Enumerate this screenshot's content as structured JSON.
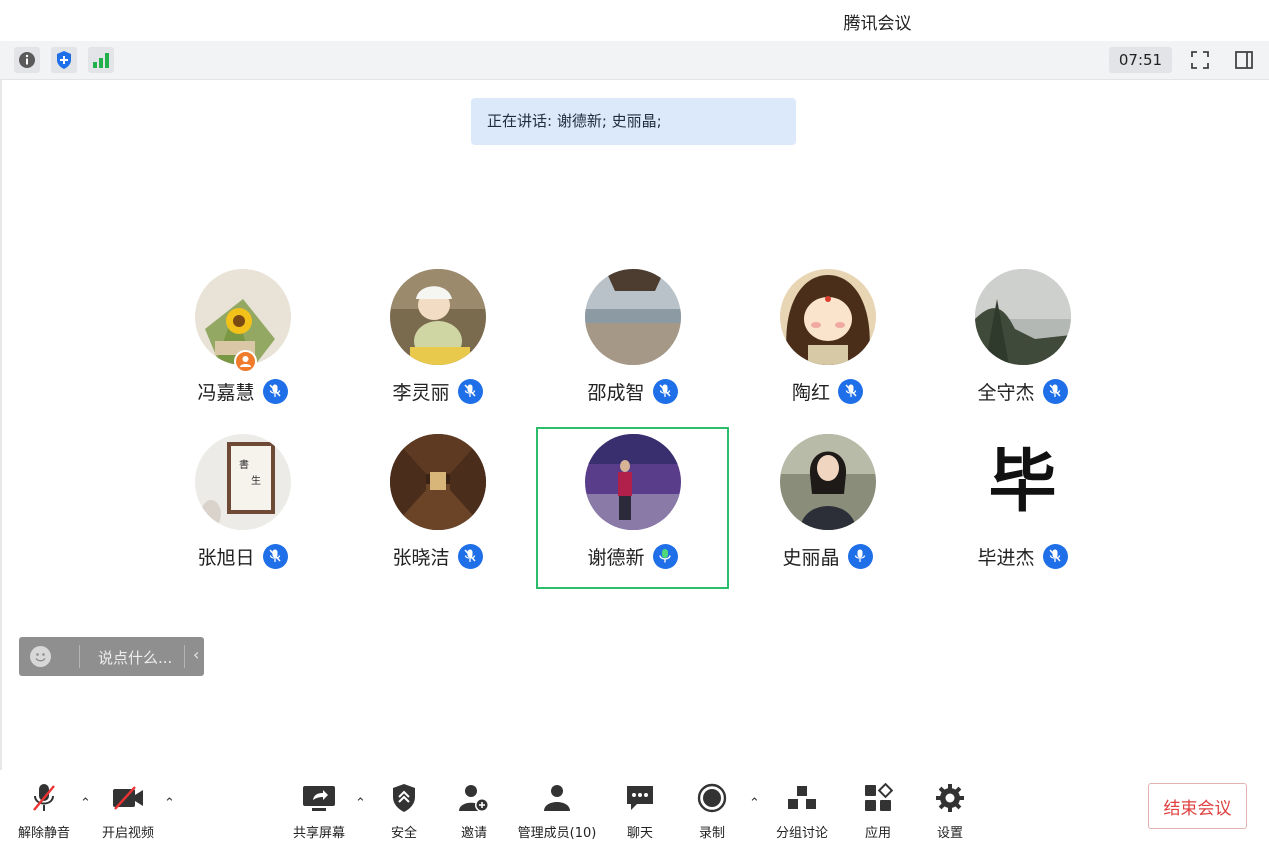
{
  "window": {
    "title": "腾讯会议"
  },
  "subbar": {
    "clock": "07:51"
  },
  "speaking": {
    "label": "正在讲话: 谢德新; 史丽晶;"
  },
  "participants": [
    {
      "name": "冯嘉慧",
      "host": true,
      "mic": "muted"
    },
    {
      "name": "李灵丽",
      "mic": "muted"
    },
    {
      "name": "邵成智",
      "mic": "muted"
    },
    {
      "name": "陶红",
      "mic": "muted"
    },
    {
      "name": "全守杰",
      "mic": "muted"
    },
    {
      "name": "张旭日",
      "mic": "muted"
    },
    {
      "name": "张晓洁",
      "mic": "muted"
    },
    {
      "name": "谢德新",
      "mic": "speaking",
      "active": true
    },
    {
      "name": "史丽晶",
      "mic": "unmuted"
    },
    {
      "name": "毕进杰",
      "mic": "muted",
      "avatar_text": "毕"
    }
  ],
  "chat": {
    "placeholder": "说点什么..."
  },
  "toolbar": {
    "unmute": "解除静音",
    "video": "开启视频",
    "share": "共享屏幕",
    "security": "安全",
    "invite": "邀请",
    "members": "管理成员(10)",
    "chat": "聊天",
    "record": "录制",
    "breakout": "分组讨论",
    "apps": "应用",
    "settings": "设置",
    "end": "结束会议"
  },
  "colors": {
    "accent": "#1e6fe8",
    "active_border": "#2dbd6a",
    "end": "#e04040",
    "speaking_bg": "#dbe9fb"
  }
}
